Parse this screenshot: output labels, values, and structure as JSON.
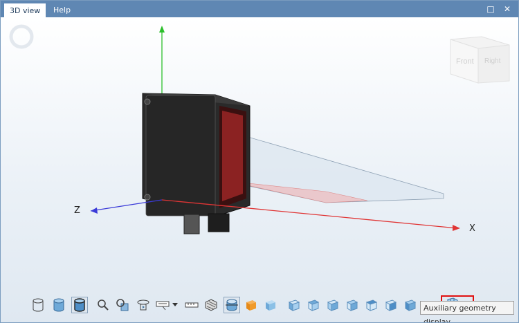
{
  "tabs": [
    {
      "label": "3D view",
      "active": true
    },
    {
      "label": "Help",
      "active": false
    }
  ],
  "window_buttons": {
    "maximize": "maximize-icon",
    "close": "close-icon"
  },
  "viewcube": {
    "front_label": "Front",
    "right_label": "Right"
  },
  "axes": {
    "x_label": "X",
    "z_label": "Z"
  },
  "colors": {
    "tab_bar": "#5f87b3",
    "x_axis": "#e03535",
    "y_axis": "#2bbf2b",
    "z_axis": "#3b3bd8",
    "highlight": "#e01010"
  },
  "toolbar": {
    "icons": [
      "wireframe-cylinder-icon",
      "shaded-cylinder-icon",
      "shaded-edges-cylinder-icon",
      "zoom-icon",
      "zoom-fit-icon",
      "rotate-view-icon",
      "dimension-icon",
      "dropdown-arrow-icon",
      "ruler-icon",
      "hatch-icon",
      "section-view-icon",
      "orange-cube-icon",
      "blue-cube-icon",
      "view-front-icon",
      "view-back-icon",
      "view-left-icon",
      "view-right-icon",
      "view-top-icon",
      "view-bottom-icon",
      "view-iso-icon",
      "plane-icon",
      "auxiliary-geometry-icon"
    ],
    "more_label": "»"
  },
  "tooltip": "Auxiliary geometry display"
}
